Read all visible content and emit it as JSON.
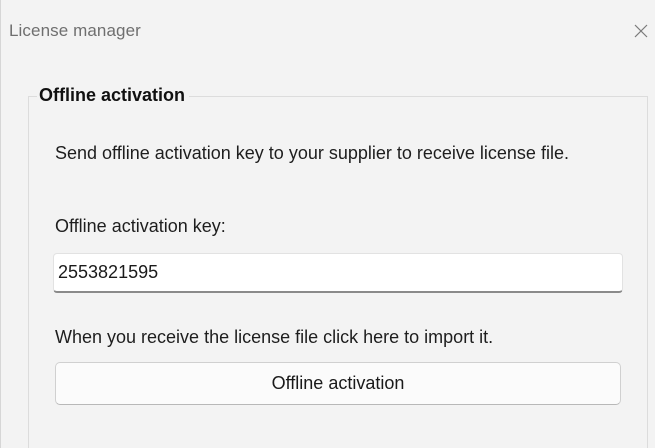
{
  "window": {
    "title": "License manager",
    "close_icon": "close-icon"
  },
  "group": {
    "title": "Offline activation",
    "instructions": "Send offline activation key to your supplier to receive license file.",
    "key_label": "Offline activation key:",
    "key_value": "2553821595",
    "import_text": "When you receive the license file click here to import it.",
    "activate_button_label": "Offline activation"
  },
  "colors": {
    "window_bg": "#f3f3f3",
    "title_text": "#6f6f6f",
    "input_bg": "#ffffff",
    "input_underline": "#8a8a8a",
    "button_bg": "#fbfbfb"
  }
}
